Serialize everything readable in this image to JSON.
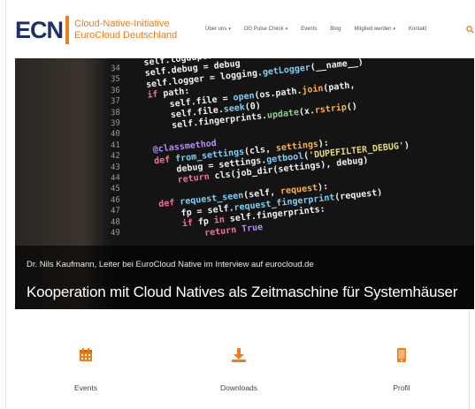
{
  "brand": {
    "mark": "ECN",
    "line1": "Cloud-Native-Initiative",
    "line2": "EuroCloud Deutschland",
    "accent_color": "#ef7d1a",
    "mark_color": "#1e2f6b"
  },
  "nav": {
    "items": [
      {
        "label": "Über uns",
        "dropdown": true
      },
      {
        "label": "OG Pulse Check",
        "dropdown": true
      },
      {
        "label": "Events",
        "dropdown": false
      },
      {
        "label": "Blog",
        "dropdown": false
      },
      {
        "label": "Mitglied werden",
        "dropdown": true
      },
      {
        "label": "Kontakt",
        "dropdown": false
      }
    ],
    "search_icon": "search-icon"
  },
  "hero": {
    "kicker": "Dr. Nils Kaufmann, Leiter bei EuroCloud Native im Interview auf eurocloud.de",
    "title": "Kooperation mit Cloud Natives als Zeitmaschine für Systemhäuser",
    "line_numbers": [
      "34",
      "35",
      "36",
      "37",
      "38",
      "39",
      "40",
      "41",
      "42",
      "43",
      "44",
      "45",
      "46",
      "47",
      "48",
      "49"
    ]
  },
  "features": [
    {
      "label": "Events",
      "icon": "calendar-icon"
    },
    {
      "label": "Downloads",
      "icon": "download-icon"
    },
    {
      "label": "Profil",
      "icon": "profile-icon"
    }
  ]
}
